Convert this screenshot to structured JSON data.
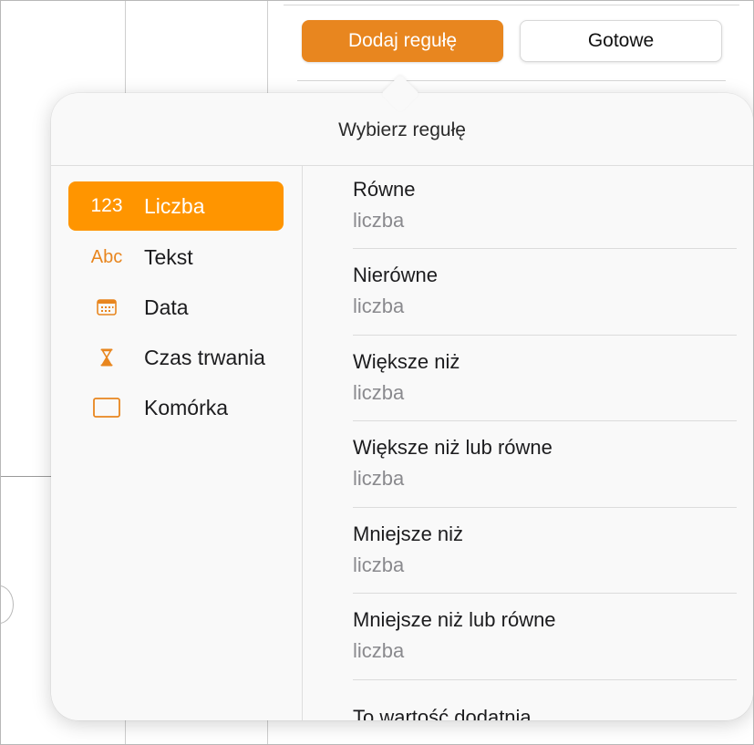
{
  "toolbar": {
    "add_rule_label": "Dodaj regułę",
    "done_label": "Gotowe"
  },
  "popover": {
    "title": "Wybierz regułę"
  },
  "categories": [
    {
      "icon_text": "123",
      "icon": "number-icon",
      "label": "Liczba",
      "selected": true
    },
    {
      "icon_text": "Abc",
      "icon": "text-icon",
      "label": "Tekst",
      "selected": false
    },
    {
      "icon_text": "",
      "icon": "calendar-icon",
      "label": "Data",
      "selected": false
    },
    {
      "icon_text": "",
      "icon": "hourglass-icon",
      "label": "Czas trwania",
      "selected": false
    },
    {
      "icon_text": "",
      "icon": "cell-icon",
      "label": "Komórka",
      "selected": false
    }
  ],
  "rules": [
    {
      "name": "Równe",
      "sub": "liczba"
    },
    {
      "name": "Nierówne",
      "sub": "liczba"
    },
    {
      "name": "Większe niż",
      "sub": "liczba"
    },
    {
      "name": "Większe niż lub równe",
      "sub": "liczba"
    },
    {
      "name": "Mniejsze niż",
      "sub": "liczba"
    },
    {
      "name": "Mniejsze niż lub równe",
      "sub": "liczba"
    },
    {
      "name": "To wartość dodatnia",
      "sub": ""
    }
  ],
  "colors": {
    "accent": "#ff9500",
    "button_orange": "#e8861f"
  }
}
